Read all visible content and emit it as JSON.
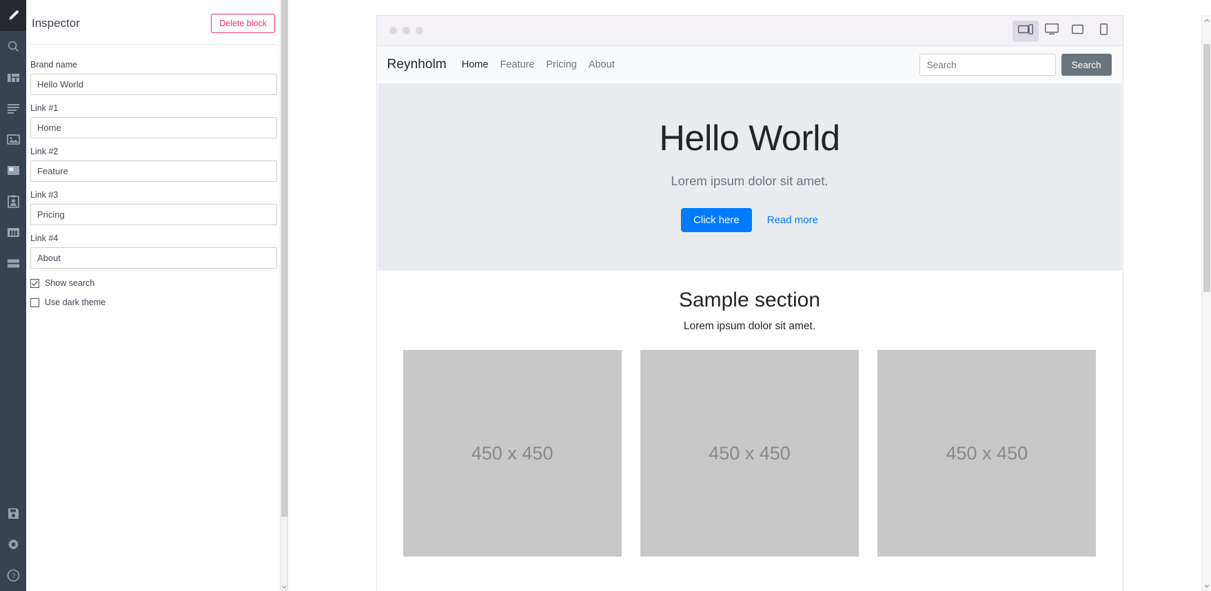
{
  "rail": {
    "items": [
      {
        "name": "edit-tool",
        "icon": "pencil-icon",
        "active": true
      },
      {
        "name": "search-tool",
        "icon": "search-icon",
        "active": false
      },
      {
        "name": "layout-tool",
        "icon": "layout-blocks-icon",
        "active": false
      },
      {
        "name": "text-tool",
        "icon": "text-lines-icon",
        "active": false
      },
      {
        "name": "image-tool",
        "icon": "image-icon",
        "active": false
      },
      {
        "name": "card-tool",
        "icon": "card-icon",
        "active": false
      },
      {
        "name": "contact-tool",
        "icon": "contact-card-icon",
        "active": false
      },
      {
        "name": "columns-tool",
        "icon": "columns-icon",
        "active": false
      },
      {
        "name": "rows-tool",
        "icon": "rows-icon",
        "active": false
      }
    ],
    "bottom_items": [
      {
        "name": "save-tool",
        "icon": "save-icon"
      },
      {
        "name": "settings-tool",
        "icon": "gear-icon"
      },
      {
        "name": "help-tool",
        "icon": "help-circle-icon"
      }
    ]
  },
  "inspector": {
    "title": "Inspector",
    "delete_label": "Delete block",
    "fields": [
      {
        "label": "Brand name",
        "value": "Hello World",
        "name": "brand-name"
      },
      {
        "label": "Link #1",
        "value": "Home",
        "name": "link-1"
      },
      {
        "label": "Link #2",
        "value": "Feature",
        "name": "link-2"
      },
      {
        "label": "Link #3",
        "value": "Pricing",
        "name": "link-3"
      },
      {
        "label": "Link #4",
        "value": "About",
        "name": "link-4"
      }
    ],
    "checkboxes": [
      {
        "label": "Show search",
        "checked": true,
        "name": "show-search"
      },
      {
        "label": "Use dark theme",
        "checked": false,
        "name": "use-dark-theme"
      }
    ]
  },
  "preview": {
    "devices": [
      {
        "name": "tablet-landscape-icon",
        "active": true
      },
      {
        "name": "desktop-icon",
        "active": false
      },
      {
        "name": "tablet-portrait-icon",
        "active": false
      },
      {
        "name": "phone-icon",
        "active": false
      }
    ],
    "site": {
      "brand": "Reynholm",
      "nav": [
        {
          "label": "Home",
          "active": true
        },
        {
          "label": "Feature",
          "active": false
        },
        {
          "label": "Pricing",
          "active": false
        },
        {
          "label": "About",
          "active": false
        }
      ],
      "search_placeholder": "Search",
      "search_value": "",
      "search_button": "Search",
      "hero": {
        "title": "Hello World",
        "subtitle": "Lorem ipsum dolor sit amet.",
        "primary_button": "Click here",
        "secondary_link": "Read more"
      },
      "section": {
        "title": "Sample section",
        "subtitle": "Lorem ipsum dolor sit amet.",
        "cards": [
          {
            "label": "450 x 450"
          },
          {
            "label": "450 x 450"
          },
          {
            "label": "450 x 450"
          }
        ]
      }
    }
  },
  "colors": {
    "rail_bg": "#39434f",
    "rail_active_bg": "#25292e",
    "delete_accent": "#e8336d",
    "primary_blue": "#007bff",
    "hero_bg": "#e9ecef",
    "card_bg": "#c8c8c8",
    "search_btn": "#6c757d"
  }
}
